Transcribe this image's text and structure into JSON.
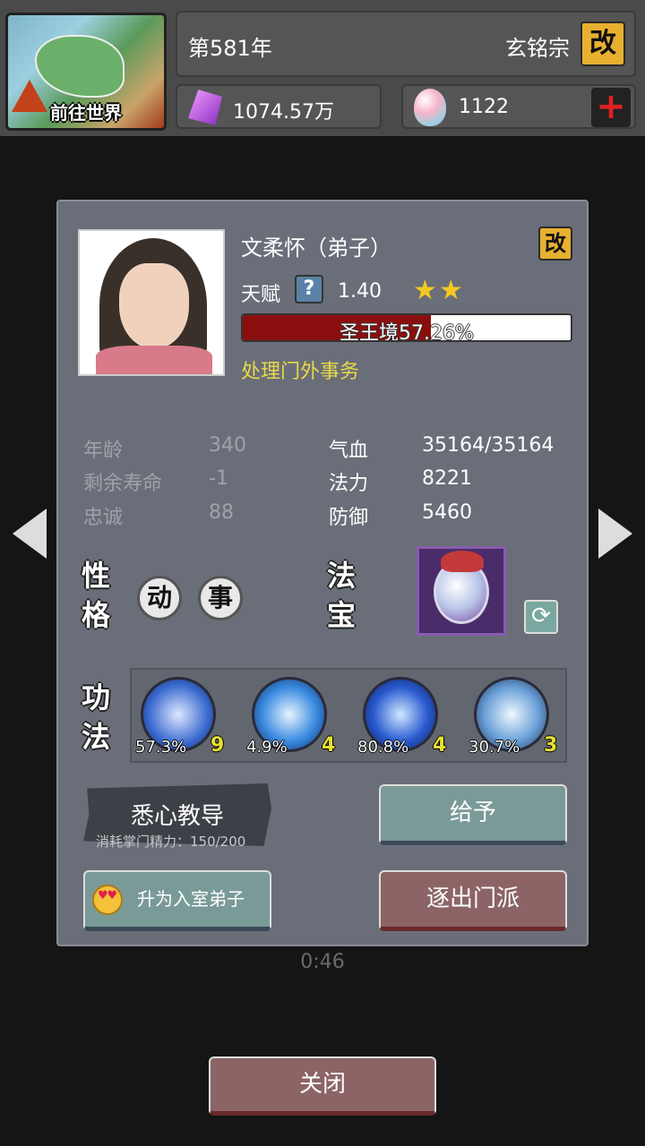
{
  "topbar": {
    "world_button_label": "前往世界",
    "year": "第581年",
    "sect_name": "玄铭宗",
    "rename_label": "改",
    "crystals": "1074.57万",
    "gems": "1122",
    "add_label": "+"
  },
  "disciple": {
    "name": "文柔怀（弟子）",
    "rename_label": "改",
    "talent_label": "天赋",
    "talent_help": "?",
    "talent_value": "1.40",
    "stars_display": "★★",
    "star_count": 2,
    "realm_text": "圣王境57.26%",
    "realm_progress": 57.26,
    "status": "处理门外事务"
  },
  "stats": {
    "age_label": "年龄",
    "age_value": "340",
    "lifespan_label": "剩余寿命",
    "lifespan_value": "-1",
    "loyalty_label": "忠诚",
    "loyalty_value": "88",
    "hp_label": "气血",
    "hp_value": "35164/35164",
    "mana_label": "法力",
    "mana_value": "8221",
    "defense_label": "防御",
    "defense_value": "5460"
  },
  "sections": {
    "personality_title": "性格",
    "artifact_title": "法宝",
    "skills_title": "功法"
  },
  "traits": [
    "动",
    "事"
  ],
  "skills": [
    {
      "pct": "57.3%",
      "level": "9",
      "icon": "yin-yang-icon"
    },
    {
      "pct": "4.9%",
      "level": "4",
      "icon": "sword-slash-icon"
    },
    {
      "pct": "80.8%",
      "level": "4",
      "icon": "whirlwind-icon"
    },
    {
      "pct": "30.7%",
      "level": "3",
      "icon": "sword-rain-icon"
    }
  ],
  "actions": {
    "teach_label": "悉心教导",
    "teach_cost": "消耗掌门精力：150/200",
    "give_label": "给予",
    "promote_label": "升为入室弟子",
    "expel_label": "逐出门派",
    "close_label": "关闭"
  },
  "background": {
    "timer": "0:46"
  },
  "colors": {
    "dialog_bg": "#6a6e78",
    "realm_fill": "#8b0e0e",
    "status_yellow": "#e8d84a",
    "star_gold": "#f4c820",
    "rename_gold": "#e8b030"
  }
}
